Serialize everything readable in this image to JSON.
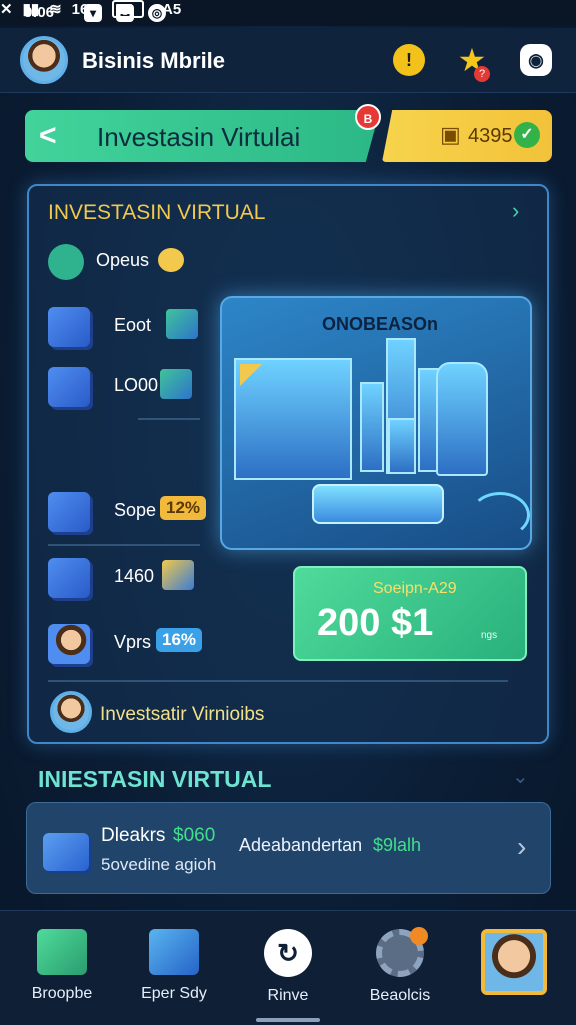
{
  "status_bar": {
    "time": "9:06",
    "battery": "16%",
    "extra": "0A5"
  },
  "header": {
    "title": "Bisinis Mbrile",
    "alert_glyph": "!",
    "star_badge": "?"
  },
  "banner": {
    "back_glyph": "<",
    "label": "Investasin Virtulai",
    "badge": "B",
    "coins": "4395"
  },
  "panel": {
    "title": "INVESTASIN VIRTUAL",
    "rows": [
      {
        "label": "Opeus"
      },
      {
        "label": "Eoot"
      },
      {
        "label": "LO00"
      },
      {
        "label": "Sope",
        "badge": "12%"
      },
      {
        "label": "1460"
      },
      {
        "label": "Vprs",
        "badge": "16%"
      }
    ],
    "illustration_title": "ONOBEASOn",
    "amount": {
      "small": "Soeipn-A29",
      "big": "200 $1",
      "tiny": "ngs"
    },
    "footer_label": "Investsatir Virnioibs"
  },
  "section": {
    "title": "INIESTASIN VIRTUAL",
    "card": {
      "line1_label": "Dleakrs",
      "line1_value": "$060",
      "line2": "5ovedine agioh",
      "mid_label": "Adeabandertan",
      "mid_value": "$9lalh"
    }
  },
  "bottom_nav": [
    {
      "label": "Broopbe"
    },
    {
      "label": "Eper Sdy"
    },
    {
      "label": "Rinve"
    },
    {
      "label": "Beaolcis"
    },
    {
      "label": ""
    }
  ],
  "colors": {
    "accent": "#f2c94c",
    "green": "#42d39b",
    "blue_border": "#3f87c8"
  }
}
